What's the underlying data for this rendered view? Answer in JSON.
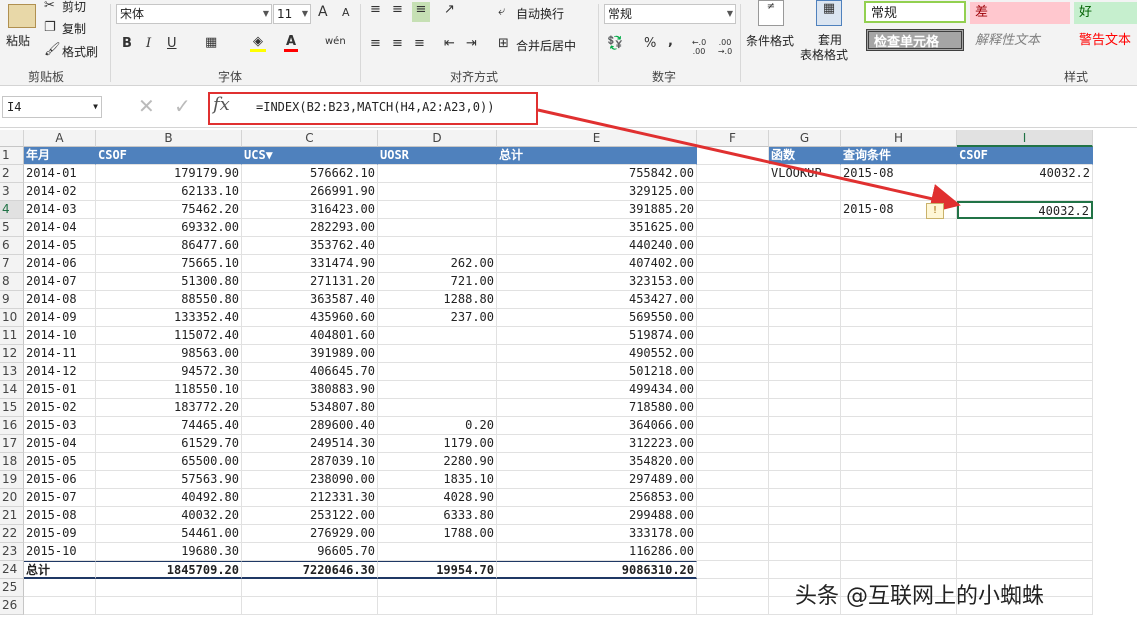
{
  "ribbon": {
    "clipboard": {
      "paste": "粘贴",
      "cut": "剪切",
      "copy": "复制",
      "format_painter": "格式刷",
      "label": "剪贴板"
    },
    "font": {
      "name": "宋体",
      "size": "11",
      "label": "字体",
      "bold": "B",
      "italic": "I",
      "underline": "U",
      "grow": "A",
      "shrink": "A",
      "wen": "wén"
    },
    "alignment": {
      "wrap_text": "自动换行",
      "merge_center": "合并后居中",
      "label": "对齐方式"
    },
    "number": {
      "format": "常规",
      "label": "数字",
      "percent": "%",
      "comma": ",",
      "inc_dec": "←.0 .00",
      "dec_dec": ".00 →.0"
    },
    "styles": {
      "conditional": "条件格式",
      "table_format_1": "套用",
      "table_format_2": "表格格式",
      "normal": "常规",
      "bad": "差",
      "good": "好",
      "check_cell": "检查单元格",
      "explanatory": "解释性文本",
      "warning": "警告文本",
      "label": "样式"
    }
  },
  "formula_bar": {
    "name_box": "I4",
    "formula": "=INDEX(B2:B23,MATCH(H4,A2:A23,0))",
    "fx": "fx"
  },
  "columns": [
    "A",
    "B",
    "C",
    "D",
    "E",
    "F",
    "G",
    "H",
    "I"
  ],
  "rows": [
    "1",
    "2",
    "3",
    "4",
    "5",
    "6",
    "7",
    "8",
    "9",
    "10",
    "11",
    "12",
    "13",
    "14",
    "15",
    "16",
    "17",
    "18",
    "19",
    "20",
    "21",
    "22",
    "23",
    "24",
    "25",
    "26"
  ],
  "table": {
    "headers": [
      "年月",
      "CSOF",
      "UCS▼",
      "UOSR",
      "总计"
    ],
    "data": [
      [
        "2014-01",
        "179179.90",
        "576662.10",
        "",
        "755842.00"
      ],
      [
        "2014-02",
        "62133.10",
        "266991.90",
        "",
        "329125.00"
      ],
      [
        "2014-03",
        "75462.20",
        "316423.00",
        "",
        "391885.20"
      ],
      [
        "2014-04",
        "69332.00",
        "282293.00",
        "",
        "351625.00"
      ],
      [
        "2014-05",
        "86477.60",
        "353762.40",
        "",
        "440240.00"
      ],
      [
        "2014-06",
        "75665.10",
        "331474.90",
        "262.00",
        "407402.00"
      ],
      [
        "2014-07",
        "51300.80",
        "271131.20",
        "721.00",
        "323153.00"
      ],
      [
        "2014-08",
        "88550.80",
        "363587.40",
        "1288.80",
        "453427.00"
      ],
      [
        "2014-09",
        "133352.40",
        "435960.60",
        "237.00",
        "569550.00"
      ],
      [
        "2014-10",
        "115072.40",
        "404801.60",
        "",
        "519874.00"
      ],
      [
        "2014-11",
        "98563.00",
        "391989.00",
        "",
        "490552.00"
      ],
      [
        "2014-12",
        "94572.30",
        "406645.70",
        "",
        "501218.00"
      ],
      [
        "2015-01",
        "118550.10",
        "380883.90",
        "",
        "499434.00"
      ],
      [
        "2015-02",
        "183772.20",
        "534807.80",
        "",
        "718580.00"
      ],
      [
        "2015-03",
        "74465.40",
        "289600.40",
        "0.20",
        "364066.00"
      ],
      [
        "2015-04",
        "61529.70",
        "249514.30",
        "1179.00",
        "312223.00"
      ],
      [
        "2015-05",
        "65500.00",
        "287039.10",
        "2280.90",
        "354820.00"
      ],
      [
        "2015-06",
        "57563.90",
        "238090.00",
        "1835.10",
        "297489.00"
      ],
      [
        "2015-07",
        "40492.80",
        "212331.30",
        "4028.90",
        "256853.00"
      ],
      [
        "2015-08",
        "40032.20",
        "253122.00",
        "6333.80",
        "299488.00"
      ],
      [
        "2015-09",
        "54461.00",
        "276929.00",
        "1788.00",
        "333178.00"
      ],
      [
        "2015-10",
        "19680.30",
        "96605.70",
        "",
        "116286.00"
      ]
    ],
    "totals": [
      "总计",
      "1845709.20",
      "7220646.30",
      "19954.70",
      "9086310.20"
    ]
  },
  "lookup": {
    "headers": [
      "函数",
      "查询条件",
      "CSOF"
    ],
    "row2": [
      "VLOOKUP",
      "2015-08",
      "40032.2"
    ],
    "row4": [
      "",
      "2015-08",
      "40032.2"
    ]
  },
  "watermark": "头条 @互联网上的小蜘蛛",
  "colors": {
    "header_blue": "#4f81bd",
    "excel_green": "#217346",
    "highlight_red": "#e03030"
  }
}
